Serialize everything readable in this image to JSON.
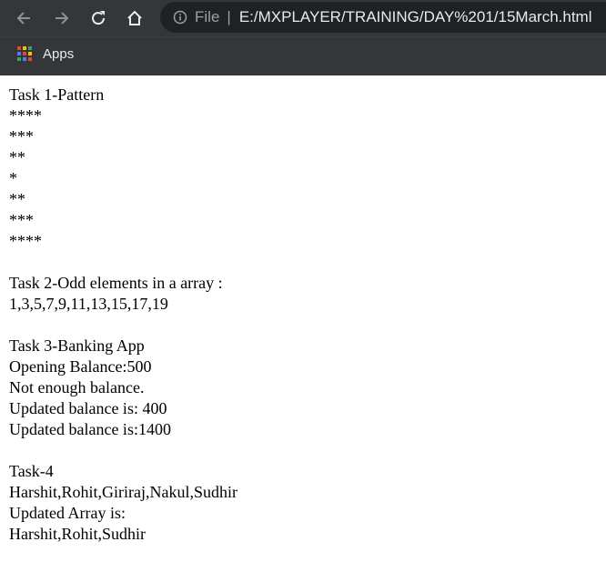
{
  "browser": {
    "address_scheme": "File",
    "address_separator": "|",
    "url": "E:/MXPLAYER/TRAINING/DAY%201/15March.html",
    "bookmarks": [
      {
        "label": "Apps",
        "icon": "apps-grid-icon"
      }
    ],
    "colors": {
      "chrome_bg": "#35363a",
      "omnibox_bg": "#202124",
      "text": "#e8eaed",
      "muted": "#9aa0a6"
    }
  },
  "page": {
    "task1": {
      "title": "Task 1-Pattern",
      "lines": [
        "****",
        "***",
        "**",
        "*",
        "**",
        "***",
        "****"
      ]
    },
    "task2": {
      "title": "Task 2-Odd elements in a array :",
      "result": "1,3,5,7,9,11,13,15,17,19"
    },
    "task3": {
      "title": "Task 3-Banking App",
      "lines": [
        "Opening Balance:500",
        "Not enough balance.",
        "Updated balance is: 400",
        "Updated balance is:1400"
      ]
    },
    "task4": {
      "title": "Task-4",
      "lines": [
        "Harshit,Rohit,Giriraj,Nakul,Sudhir",
        "Updated Array is:",
        "Harshit,Rohit,Sudhir"
      ]
    }
  }
}
